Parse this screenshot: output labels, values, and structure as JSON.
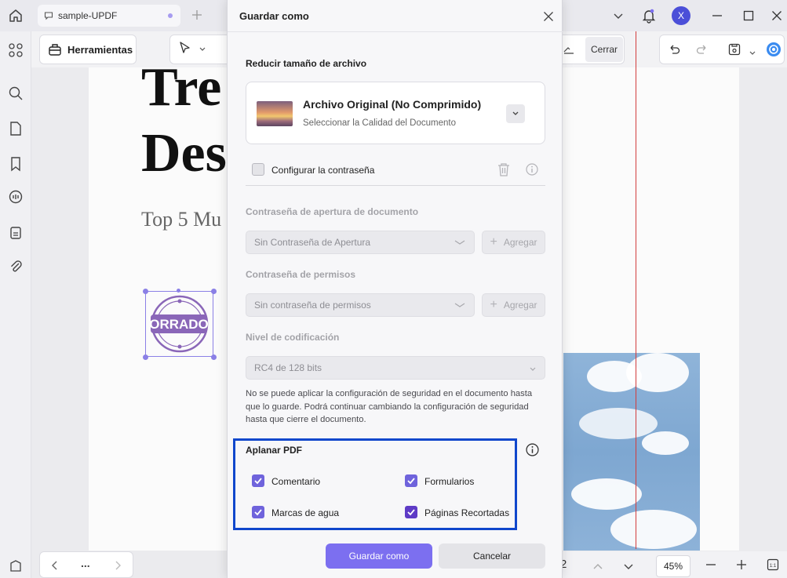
{
  "app": {
    "tab_title": "sample-UPDF",
    "avatar_letter": "X",
    "accent": "#7c6ff0"
  },
  "toolbar": {
    "tools_label": "Herramientas",
    "close_label": "Cerrar"
  },
  "document": {
    "title_lines": [
      "Tre",
      "Des"
    ],
    "subtitle": "Top 5 Mu",
    "stamp_text": "ORRADO"
  },
  "bottombar": {
    "page_fragment": "2",
    "zoom": "45%",
    "more": "..."
  },
  "dialog": {
    "title": "Guardar como",
    "reduce_title": "Reducir tamaño de archivo",
    "quality_title": "Archivo Original (No Comprimido)",
    "quality_sub": "Seleccionar la Calidad del Documento",
    "password_toggle": "Configurar la contraseña",
    "open_pw_title": "Contraseña de apertura de documento",
    "open_pw_value": "Sin Contraseña de Apertura",
    "perm_pw_title": "Contraseña de permisos",
    "perm_pw_value": "Sin contraseña de permisos",
    "add_label": "Agregar",
    "encrypt_title": "Nivel de codificación",
    "encrypt_value": "RC4 de 128 bits",
    "note": "No se puede aplicar la configuración de seguridad en el documento hasta que lo guarde. Podrá continuar cambiando la configuración de seguridad hasta que cierre el documento.",
    "flatten_title": "Aplanar PDF",
    "flatten_options": [
      {
        "label": "Comentario",
        "checked": true
      },
      {
        "label": "Formularios",
        "checked": true
      },
      {
        "label": "Marcas de agua",
        "checked": true
      },
      {
        "label": "Páginas Recortadas",
        "checked": true
      }
    ],
    "save_label": "Guardar como",
    "cancel_label": "Cancelar"
  }
}
